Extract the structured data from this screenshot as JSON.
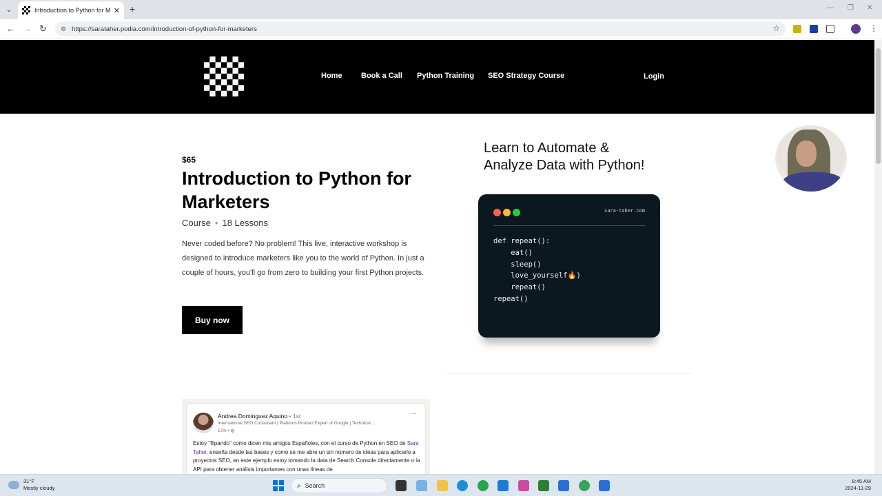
{
  "browser": {
    "tab_title": "Introduction to Python for Marketers",
    "tab_close": "✕",
    "new_tab": "+",
    "url": "https://sarataher.podia.com/introduction-of-python-for-marketers"
  },
  "site": {
    "nav": [
      "Home",
      "Book a Call",
      "Python Training",
      "SEO Strategy Course"
    ],
    "login": "Login"
  },
  "course": {
    "price": "$65",
    "title": "Introduction to Python for Marketers",
    "type": "Course",
    "lessons": "18 Lessons",
    "description": "Never coded before? No problem! This live, interactive workshop is designed to introduce marketers like you to the world of Python. In just a couple of hours, you'll go from zero to building your first Python projects.",
    "buy_label": "Buy now"
  },
  "promo": {
    "heading": "Learn to Automate & Analyze Data with Python!",
    "domain": "sara-taher.com",
    "code_lines": [
      "def repeat():",
      "    eat()",
      "    sleep()",
      "    love_yourself",
      "    repeat()",
      "",
      "repeat()"
    ],
    "flame": "🔥",
    "after_flame": ")"
  },
  "post": {
    "author": "Andrea Dominguez Aquino",
    "degree": "• 1st",
    "headline": "International SEO Consultant | Platinum Product Expert of Google | Technical ...",
    "time": "17m •",
    "more": "···",
    "body_before": "Estoy \"flipando\" como dicen mis amigos Españoles, con el curso de Python en SEO de ",
    "body_link": "Sara Taher",
    "body_after": ", enseña desde las bases y como se me abre un sin número de ideas para aplicarlo a proyectos SEO, en este ejemplo estoy tomando la data de Search Console directamente o la API para obtener análisis importantes con unas líneas de"
  },
  "taskbar": {
    "temp": "31°F",
    "condition": "Mostly cloudy",
    "search": "Search",
    "time": "8:45 AM",
    "date": "2024-11-29"
  },
  "colors": {
    "header_bg": "#000000",
    "code_bg": "#0c1820",
    "dot_red": "#ff5f56",
    "dot_yellow": "#ffbd2e",
    "dot_green": "#27c93f",
    "link_purple": "#5a2ea6"
  }
}
